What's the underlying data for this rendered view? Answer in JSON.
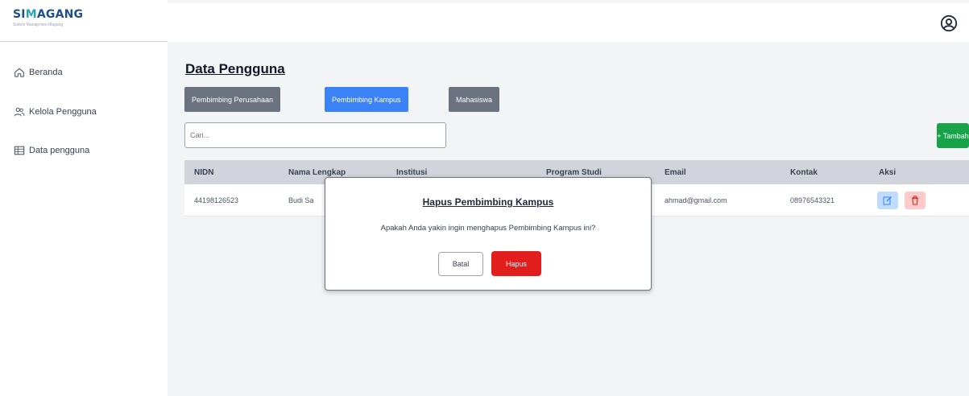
{
  "brand": {
    "name_prefix": "SI",
    "name_mark": "M",
    "name_suffix": "AGANG",
    "tagline": "Sistem Manajemen Magang"
  },
  "sidebar": {
    "items": [
      {
        "label": "Beranda",
        "icon": "home-icon"
      },
      {
        "label": "Kelola Pengguna",
        "icon": "users-icon"
      },
      {
        "label": "Data pengguna",
        "icon": "table-icon"
      }
    ]
  },
  "header": {
    "user_icon": "user-circle-icon"
  },
  "main": {
    "title": "Data Pengguna",
    "tabs": [
      {
        "label": "Pembimbing Perusahaan",
        "active": false
      },
      {
        "label": "Pembimbing Kampus",
        "active": true
      },
      {
        "label": "Mahasiswa",
        "active": false
      }
    ],
    "search": {
      "placeholder": "Cari..."
    },
    "add_button": "+ Tambah",
    "table": {
      "columns": [
        "NIDN",
        "Nama Lengkap",
        "Institusi",
        "Program Studi",
        "Email",
        "Kontak",
        "Aksi"
      ],
      "rows": [
        {
          "nidn": "44198126523",
          "nama": "Budi Sa",
          "institusi": "",
          "prodi": "",
          "email": "ahmad@gmail.com",
          "kontak": "08976543321"
        }
      ]
    }
  },
  "modal": {
    "title": "Hapus Pembimbing Kampus",
    "message": "Apakah Anda yakin ingin menghapus Pembimbing Kampus ini?",
    "cancel_label": "Batal",
    "confirm_label": "Hapus"
  },
  "colors": {
    "primary": "#3b82f6",
    "success": "#16a34a",
    "danger": "#e11d1d",
    "tab_inactive": "#6b7280"
  }
}
